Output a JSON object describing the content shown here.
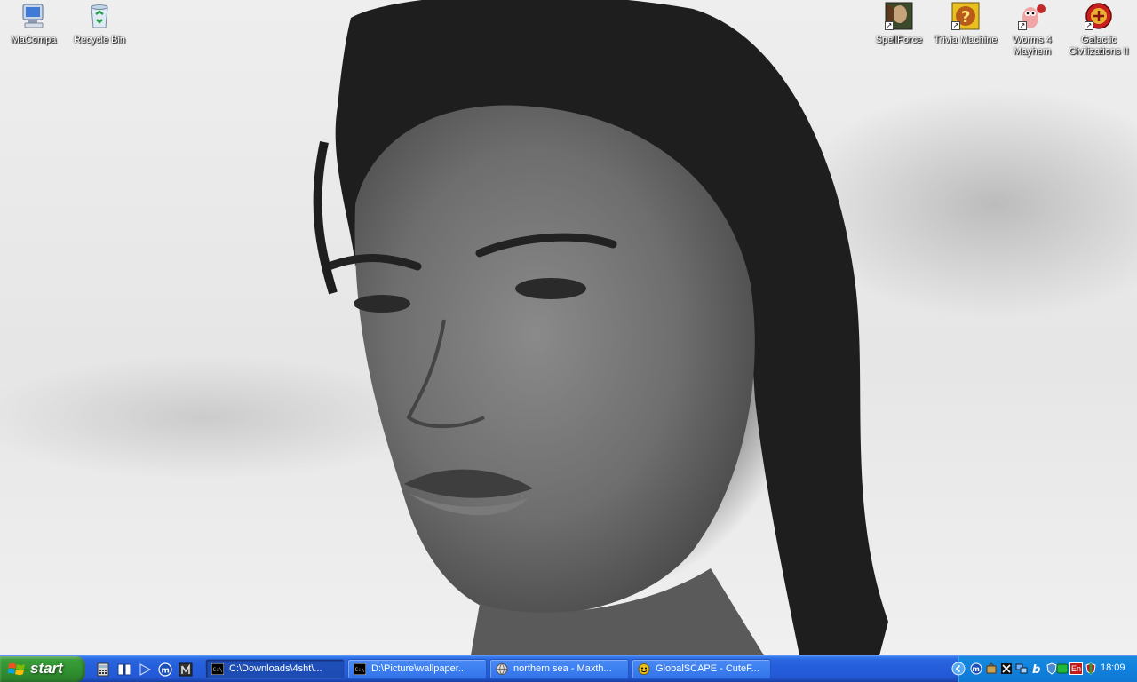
{
  "desktop": {
    "icons_left": [
      {
        "label": "MaCompa",
        "icon": "my-computer-icon"
      },
      {
        "label": "Recycle Bin",
        "icon": "recycle-bin-icon"
      }
    ],
    "icons_right": [
      {
        "label": "SpellForce",
        "icon": "spellforce-icon"
      },
      {
        "label": "Trivia Machine",
        "icon": "trivia-machine-icon"
      },
      {
        "label": "Worms 4 Mayhem",
        "icon": "worms-icon"
      },
      {
        "label": "Galactic Civilizations II",
        "icon": "galactic-civ-icon"
      }
    ]
  },
  "taskbar": {
    "start_label": "start",
    "quick_launch": [
      "calculator-icon",
      "book-icon",
      "media-player-icon",
      "maxthon-icon",
      "app-icon"
    ],
    "tasks": [
      {
        "label": "C:\\Downloads\\4sht\\...",
        "icon": "cmd-icon",
        "active": true
      },
      {
        "label": "D:\\Picture\\wallpaper...",
        "icon": "cmd-icon",
        "active": false
      },
      {
        "label": "northern sea - Maxth...",
        "icon": "browser-icon",
        "active": false
      },
      {
        "label": "GlobalSCAPE - CuteF...",
        "icon": "ftp-icon",
        "active": false
      }
    ],
    "tray": {
      "icons": [
        "collapse-arrow-icon",
        "maxthon-tray-icon",
        "tool-icon",
        "network-icon",
        "b-icon",
        "shield-icon",
        "green-icon",
        "language-icon",
        "security-icon"
      ],
      "language": "En",
      "clock": "18:09"
    }
  }
}
